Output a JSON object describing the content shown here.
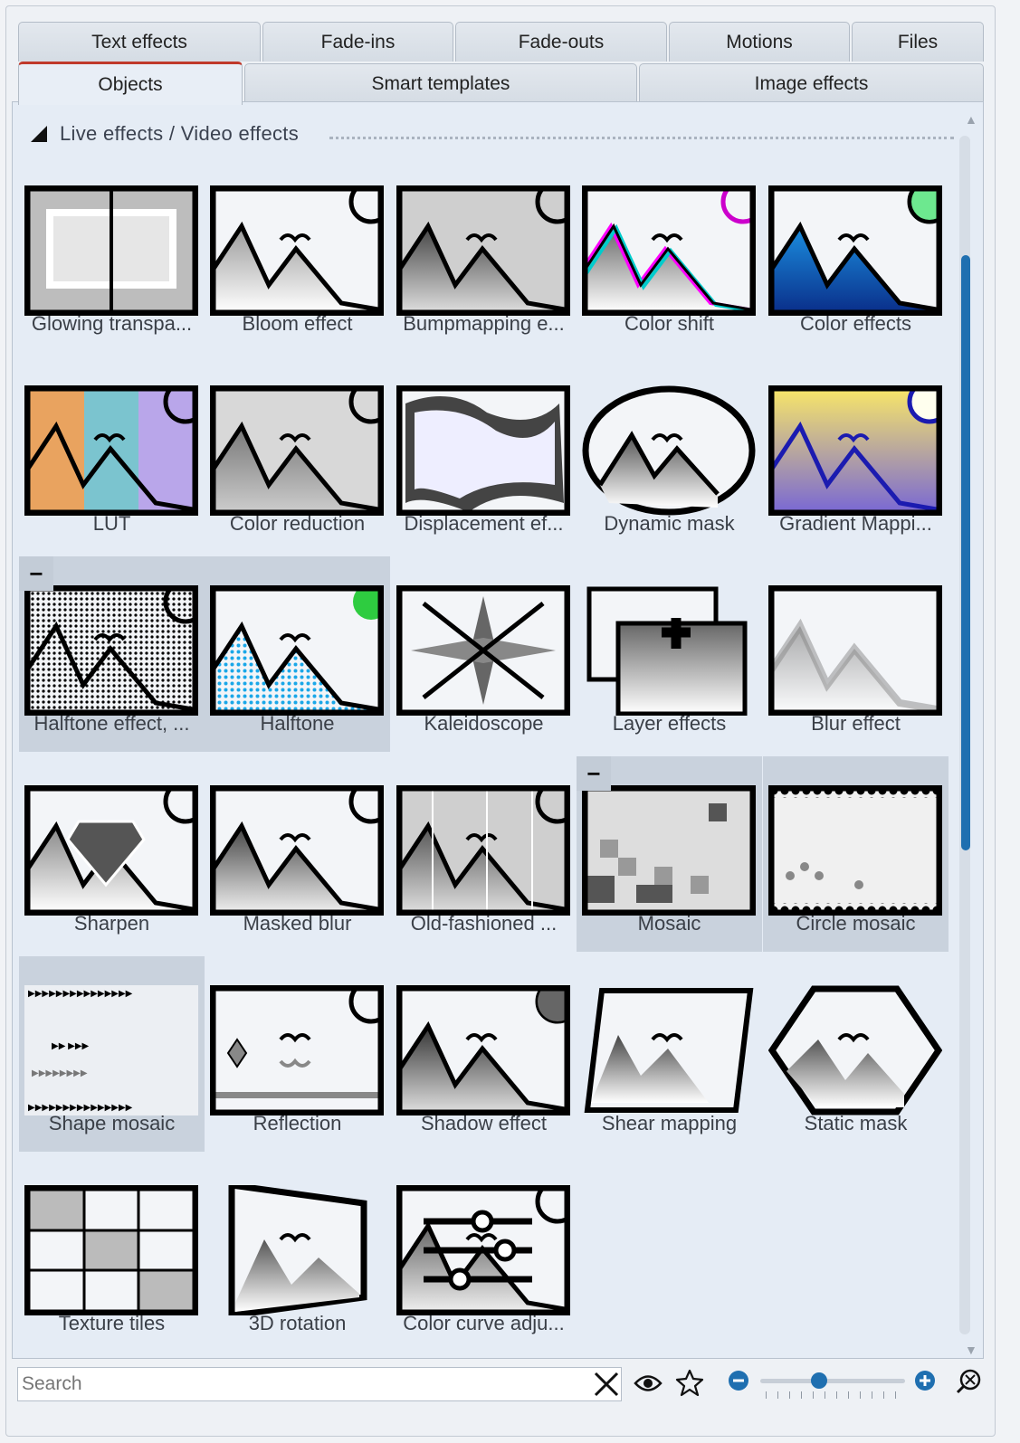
{
  "tabs_row1": [
    {
      "label": "Text effects"
    },
    {
      "label": "Fade-ins"
    },
    {
      "label": "Fade-outs"
    },
    {
      "label": "Motions"
    },
    {
      "label": "Files"
    }
  ],
  "tabs_row2": [
    {
      "label": "Objects",
      "active": true
    },
    {
      "label": "Smart templates"
    },
    {
      "label": "Image effects"
    }
  ],
  "section": {
    "title": "Live effects / Video effects"
  },
  "items": [
    {
      "label": "Glowing transpa...",
      "icon": "glowing-transparency"
    },
    {
      "label": "Bloom effect",
      "icon": "bloom"
    },
    {
      "label": "Bumpmapping e...",
      "icon": "bumpmapping"
    },
    {
      "label": "Color shift",
      "icon": "color-shift"
    },
    {
      "label": "Color effects",
      "icon": "color-effects"
    },
    {
      "label": "LUT",
      "icon": "lut"
    },
    {
      "label": "Color reduction",
      "icon": "color-reduction"
    },
    {
      "label": "Displacement ef...",
      "icon": "displacement"
    },
    {
      "label": "Dynamic mask",
      "icon": "dynamic-mask"
    },
    {
      "label": "Gradient Mappi...",
      "icon": "gradient-mapping"
    },
    {
      "label": "Halftone effect, ...",
      "icon": "halftone-bw",
      "group_selected": true
    },
    {
      "label": "Halftone",
      "icon": "halftone-color",
      "group_selected": true
    },
    {
      "label": "Kaleidoscope",
      "icon": "kaleidoscope"
    },
    {
      "label": "Layer effects",
      "icon": "layer-effects"
    },
    {
      "label": "Blur effect",
      "icon": "blur"
    },
    {
      "label": "Sharpen",
      "icon": "sharpen"
    },
    {
      "label": "Masked blur",
      "icon": "masked-blur"
    },
    {
      "label": "Old-fashioned ...",
      "icon": "old-fashioned"
    },
    {
      "label": "Mosaic",
      "icon": "mosaic",
      "group_selected": true
    },
    {
      "label": "Circle mosaic",
      "icon": "circle-mosaic",
      "group_selected": true
    },
    {
      "label": "Shape mosaic",
      "icon": "shape-mosaic",
      "group_selected": true
    },
    {
      "label": "Reflection",
      "icon": "reflection"
    },
    {
      "label": "Shadow effect",
      "icon": "shadow"
    },
    {
      "label": "Shear mapping",
      "icon": "shear-mapping"
    },
    {
      "label": "Static mask",
      "icon": "static-mask"
    },
    {
      "label": "Texture tiles",
      "icon": "texture-tiles"
    },
    {
      "label": "3D rotation",
      "icon": "3d-rotation"
    },
    {
      "label": "Color curve adju...",
      "icon": "color-curve"
    }
  ],
  "search": {
    "placeholder": "Search"
  },
  "bottom_icons": [
    "clear-icon",
    "eye-icon",
    "star-icon",
    "zoom-out-icon",
    "zoom-in-icon",
    "zoom-fit-icon"
  ],
  "zoom_level": 0.4,
  "colors": {
    "accent": "#1f6fb0",
    "active_tab_line": "#c0392b"
  }
}
